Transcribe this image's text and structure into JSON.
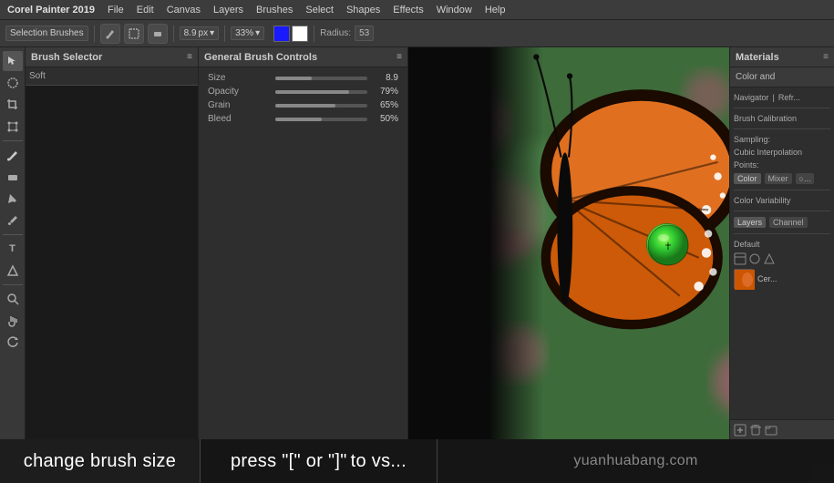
{
  "app": {
    "title": "Corel Painter 2019",
    "menu_items": [
      "Corel Painter 2019",
      "File",
      "Edit",
      "Canvas",
      "Layers",
      "Brushes",
      "Select",
      "Shapes",
      "Effects",
      "Window",
      "Help"
    ]
  },
  "toolbar": {
    "preset_label": "Selection Brushes",
    "brush_size": "8.9",
    "size_unit": "px",
    "zoom": "33%",
    "radius_label": "Radius:",
    "radius_value": "53"
  },
  "brush_selector": {
    "title": "Brush Selector",
    "preset": "Soft"
  },
  "brush_controls": {
    "title": "General Brush Controls"
  },
  "materials": {
    "title": "Materials"
  },
  "color_and": {
    "title": "Color and"
  },
  "right_panel": {
    "navigator_label": "Navigator",
    "sampling_label": "Sampling:",
    "sampling_value": "Cubic Interpolation",
    "points_label": "Points:",
    "color_variability_label": "Color Variability",
    "layers_label": "Layers",
    "channels_label": "Channel",
    "default_label": "Default"
  },
  "status_bar": {
    "tip_label": "change brush size",
    "tip_shortcut": "press \"[\" or \"]\"",
    "tip_extra": "to vs..."
  },
  "canvas": {
    "brush_cursor_top": "195",
    "brush_cursor_left": "270"
  },
  "icons": {
    "search": "🔍",
    "settings": "⚙",
    "close": "✕",
    "arrow_down": "▾",
    "menu": "≡",
    "brush": "🖌",
    "eraser": "◻",
    "zoom_in": "+",
    "zoom_out": "−",
    "hand": "✋",
    "lasso": "⌖",
    "text": "T",
    "shape": "△",
    "eyedropper": "⊕",
    "rotate": "↻"
  }
}
